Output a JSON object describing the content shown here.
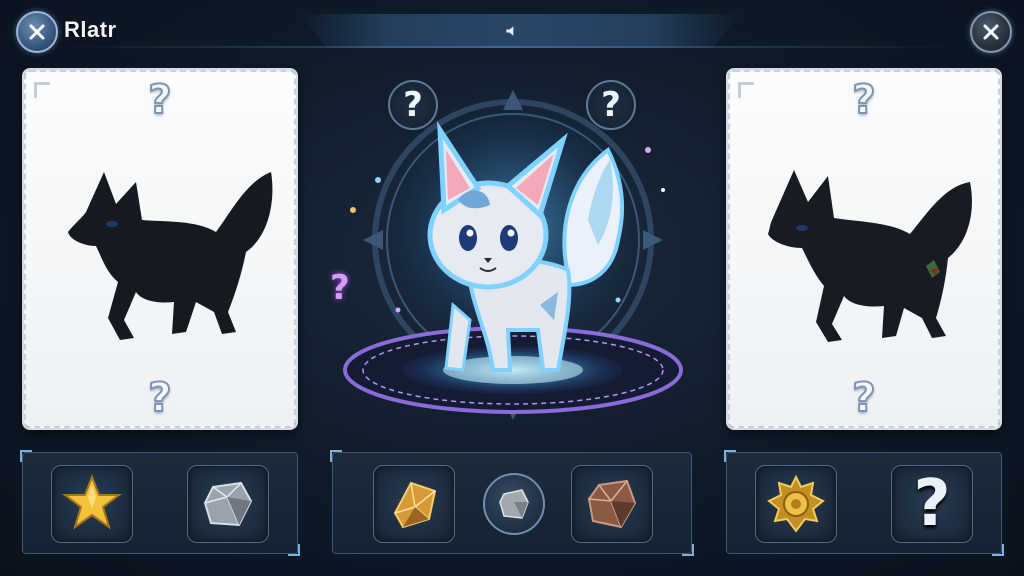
{
  "header": {
    "title": "Rlatr",
    "back_icon": "close-icon",
    "close_icon": "close-icon",
    "sound_icon": "speaker-icon"
  },
  "left_card": {
    "top_mark": "?",
    "bottom_mark": "?",
    "creature": "black-fox-silhouette-icon"
  },
  "center": {
    "left_mark": "?",
    "right_mark": "?",
    "side_mark": "?",
    "creature": "glowing-fox-creature-icon"
  },
  "right_card": {
    "top_mark": "?",
    "bottom_mark": "?",
    "creature": "black-fox-silhouette-icon"
  },
  "bottom_panels": {
    "left": [
      "gold-star-icon",
      "silver-gem-icon"
    ],
    "center": [
      "amber-crystal-icon",
      "gray-stone-icon",
      "brown-gem-icon"
    ],
    "right": [
      "gold-medallion-icon",
      "?"
    ]
  },
  "colors": {
    "background": "#0f1a28",
    "glow": "#6fc8ff",
    "card": "#f4f6f8",
    "rune_ring": "#8a6bd9"
  }
}
